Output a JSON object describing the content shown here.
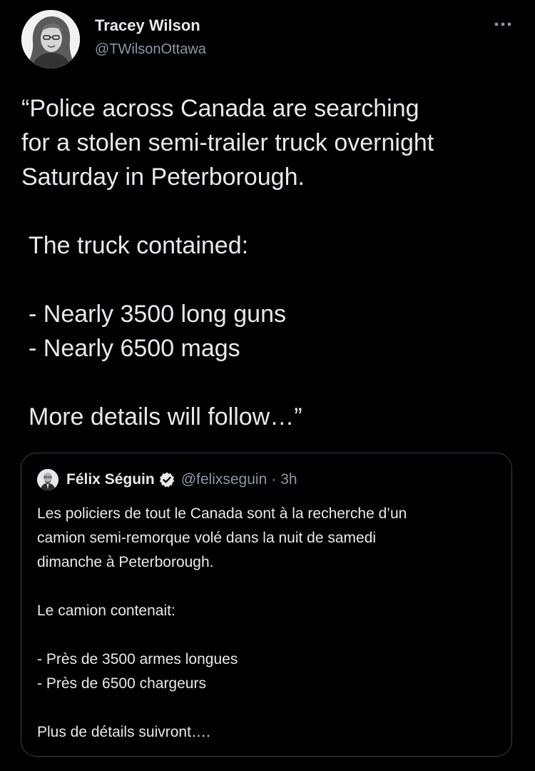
{
  "tweet": {
    "author": {
      "name": "Tracey Wilson",
      "handle": "@TWilsonOttawa"
    },
    "text_lines": [
      "“Police across Canada are searching",
      "for a stolen semi-trailer truck overnight",
      "Saturday in Peterborough.",
      "The truck contained:",
      "- Nearly 3500 long guns",
      "- Nearly 6500 mags",
      "More details will follow…”"
    ]
  },
  "quoted_tweet": {
    "author": {
      "name": "Félix Séguin",
      "handle": "@felixseguin",
      "separator": "·",
      "time": "3h"
    },
    "text_lines": [
      "Les policiers de tout le Canada sont à la recherche d’un",
      "camion semi-remorque volé dans la nuit de samedi",
      "dimanche à Peterborough.",
      "Le camion contenait:",
      "- Près de 3500 armes longues",
      "- Près de 6500 chargeurs",
      "Plus de détails suivront…."
    ]
  },
  "icons": {
    "more": "more-horizontal-icon",
    "verified": "verified-badge-icon"
  },
  "colors": {
    "background": "#000000",
    "text": "#e7e9ea",
    "secondary_text": "#8b98a5",
    "verified": "#e7e9ea",
    "quote_border": "#3a3f44"
  }
}
